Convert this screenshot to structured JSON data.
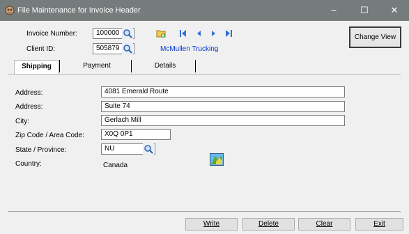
{
  "window": {
    "title": "File Maintenance for Invoice Header",
    "controls": {
      "minimize": "–",
      "maximize": "☐",
      "close": "✕"
    }
  },
  "header": {
    "invoice_number_label": "Invoice Number:",
    "invoice_number_value": "100000",
    "client_id_label": "Client ID:",
    "client_id_value": "505879",
    "client_name": "McMullen Trucking",
    "change_view_label": "Change View"
  },
  "tabs": [
    {
      "label": "Shipping",
      "active": true
    },
    {
      "label": "Payment",
      "active": false
    },
    {
      "label": "Details",
      "active": false
    }
  ],
  "shipping": {
    "address1_label": "Address:",
    "address1_value": "4081 Emerald Route",
    "address2_label": "Address:",
    "address2_value": "Suite 74",
    "city_label": "City:",
    "city_value": "Gerlach Mill",
    "zip_label": "Zip Code / Area Code:",
    "zip_value": "X0Q 0P1",
    "state_label": "State / Province:",
    "state_value": "NU",
    "country_label": "Country:",
    "country_value": "Canada"
  },
  "footer": {
    "write_label": "Write",
    "delete_label": "Delete",
    "clear_label": "Clear",
    "exit_label": "Exit"
  },
  "icons": {
    "app": "app-icon",
    "search": "magnifier-icon",
    "new_record": "new-record-icon",
    "first": "first-record-icon",
    "prev": "previous-record-icon",
    "next": "next-record-icon",
    "last": "last-record-icon",
    "map": "map-icon"
  },
  "colors": {
    "titlebar": "#767b7b",
    "link": "#0033cc",
    "nav_blue": "#2f6fd6"
  }
}
